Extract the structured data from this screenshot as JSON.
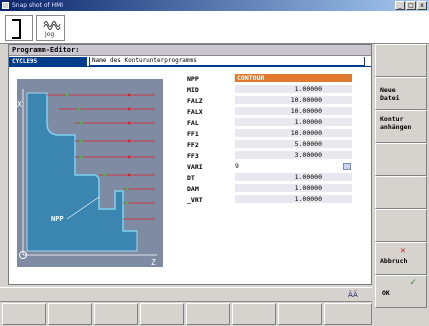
{
  "window": {
    "title": "Snap shot of HMI",
    "controls": [
      "_",
      "□",
      "x"
    ]
  },
  "header": {
    "jog_label": "Jog"
  },
  "editor": {
    "title": "Programm-Editor:",
    "cycle_tab": "CYCLE95",
    "description": "Name des Konturunterprogramms"
  },
  "drawing": {
    "npp_label": "NPP",
    "x_axis": "X",
    "z_axis": "Z"
  },
  "parameters": [
    {
      "name": "NPP",
      "value": "CONTOUR"
    },
    {
      "name": "MID",
      "value": "1.00000"
    },
    {
      "name": "FALZ",
      "value": "10.00000"
    },
    {
      "name": "FALX",
      "value": "10.00000"
    },
    {
      "name": "FAL",
      "value": "1.00000"
    },
    {
      "name": "FF1",
      "value": "10.00000"
    },
    {
      "name": "FF2",
      "value": "5.00000"
    },
    {
      "name": "FF3",
      "value": "3.00000"
    },
    {
      "name": "VARI",
      "value": "9"
    },
    {
      "name": "DT",
      "value": "1.00000"
    },
    {
      "name": "DAM",
      "value": "1.00000"
    },
    {
      "name": "_VRT",
      "value": "1.00000"
    }
  ],
  "softkeys": {
    "new_file": "Neue\nDatei",
    "append_contour": "Kontur\nanhängen",
    "cancel": "Abbruch",
    "ok": "OK"
  },
  "colors": {
    "accent_orange": "#e07a2e",
    "tab_blue": "#003c8a",
    "contour_cyan": "#4aa8c8"
  }
}
